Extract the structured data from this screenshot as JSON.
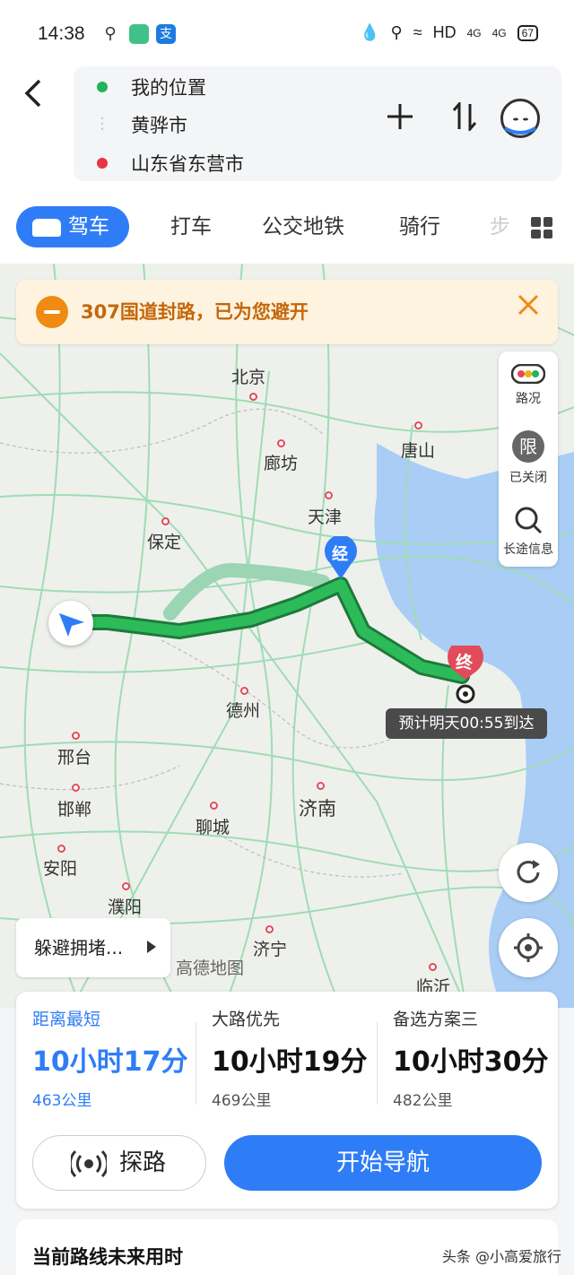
{
  "status_bar": {
    "time": "14:38",
    "network": "HD",
    "signal1": "4G",
    "signal2": "4G",
    "battery": "67",
    "app_icon_2": "支"
  },
  "route_header": {
    "origin": "我的位置",
    "waypoint": "黄骅市",
    "destination": "山东省东营市"
  },
  "tabs": [
    {
      "label": "驾车"
    },
    {
      "label": "打车"
    },
    {
      "label": "公交地铁"
    },
    {
      "label": "骑行"
    },
    {
      "label": "步"
    }
  ],
  "notice": {
    "text": "307国道封路，已为您避开"
  },
  "map": {
    "cities": [
      "北京",
      "廊坊",
      "唐山",
      "天津",
      "保定",
      "德州",
      "邢台",
      "邯郸",
      "聊城",
      "济南",
      "安阳",
      "濮阳",
      "济宁",
      "临沂"
    ],
    "waypoint_marker": "经",
    "end_marker": "终",
    "eta": "预计明天00:55到达",
    "watermark": "高德地图",
    "avoid_label": "躲避拥堵..."
  },
  "side_tools": [
    {
      "label": "路况",
      "icon": "traffic-light-icon"
    },
    {
      "label": "已关闭",
      "icon": "restriction-icon",
      "glyph": "限"
    },
    {
      "label": "长途信息",
      "icon": "search-icon"
    }
  ],
  "route_options": [
    {
      "label": "距离最短",
      "duration": "10小时17分",
      "distance": "463公里",
      "active": true
    },
    {
      "label": "大路优先",
      "duration": "10小时19分",
      "distance": "469公里",
      "active": false
    },
    {
      "label": "备选方案三",
      "duration": "10小时30分",
      "distance": "482公里",
      "active": false
    }
  ],
  "actions": {
    "probe": "探路",
    "start": "开始导航"
  },
  "future_section": {
    "title": "当前路线未来用时"
  },
  "credit": "头条 @小高爱旅行",
  "colors": {
    "accent": "#2f7df6",
    "route": "#1fa44b",
    "warning": "#f08a13",
    "end": "#e24b5a"
  }
}
